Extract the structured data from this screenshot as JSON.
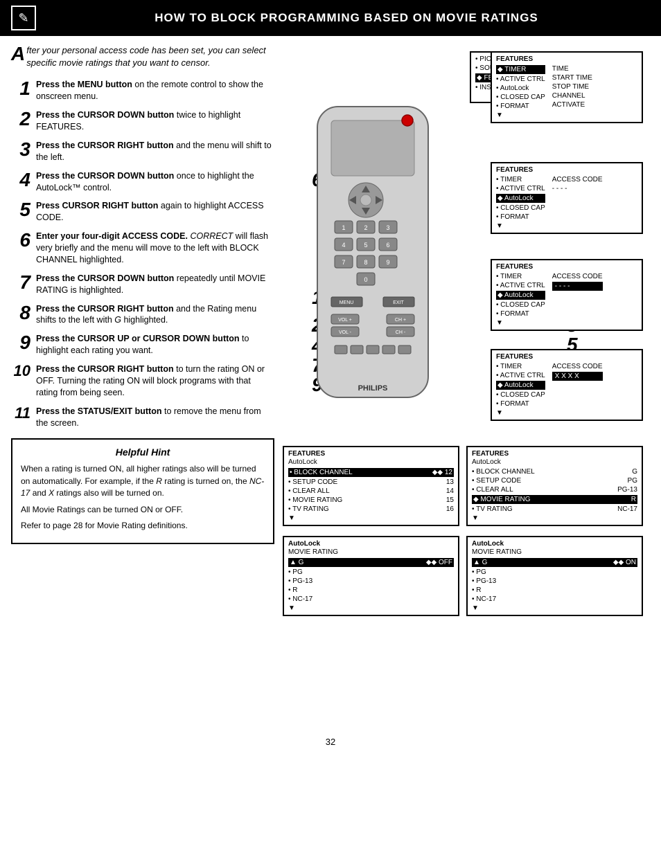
{
  "header": {
    "icon": "📋",
    "title": "How to Block Programming Based on Movie Ratings"
  },
  "intro": {
    "drop_cap": "A",
    "text": "fter your personal access code has been set, you can select specific movie ratings that you want to censor."
  },
  "steps": [
    {
      "number": "1",
      "text_html": "<strong>Press the MENU button</strong> on the remote control to show the onscreen menu."
    },
    {
      "number": "2",
      "text_html": "<strong>Press the CURSOR DOWN button</strong> twice to highlight FEATURES."
    },
    {
      "number": "3",
      "text_html": "<strong>Press the CURSOR RIGHT button</strong> and the menu will shift to the left."
    },
    {
      "number": "4",
      "text_html": "<strong>Press the CURSOR DOWN button</strong> once to highlight the AutoLock™ control."
    },
    {
      "number": "5",
      "text_html": "<strong>Press CURSOR RIGHT button</strong> again to highlight ACCESS CODE."
    },
    {
      "number": "6",
      "text_html": "<strong>Enter your four-digit ACCESS CODE.</strong> <em>CORRECT</em> will flash very briefly and the menu will move to the left with BLOCK CHANNEL highlighted."
    },
    {
      "number": "7",
      "text_html": "<strong>Press the CURSOR DOWN button</strong> repeatedly until MOVIE RATING is highlighted."
    },
    {
      "number": "8",
      "text_html": "<strong>Press the CURSOR RIGHT button</strong> and the Rating menu shifts to the left with <em>G</em> highlighted."
    },
    {
      "number": "9",
      "text_html": "<strong>Press the CURSOR UP or CURSOR DOWN button</strong> to highlight each rating you want."
    },
    {
      "number": "10",
      "text_html": "<strong>Press the CURSOR RIGHT button</strong> to turn the rating ON or OFF. Turning the rating ON will block programs with that rating from being seen."
    },
    {
      "number": "11",
      "text_html": "<strong>Press the STATUS/EXIT button</strong> to remove the menu from the screen."
    }
  ],
  "hint": {
    "title": "Helpful Hint",
    "paragraphs": [
      "When a rating is turned ON, all higher ratings also will be turned on automatically. For example, if the R rating is turned on, the NC-17 and X ratings also will be turned on.",
      "All Movie Ratings can be turned ON or OFF.",
      "Refer to page 28 for Movie Rating definitions."
    ]
  },
  "menu_boxes": {
    "top_left": {
      "header": "",
      "items": [
        {
          "text": "• PICTURE",
          "highlighted": false
        },
        {
          "text": "• SOUND",
          "highlighted": false
        },
        {
          "text": "◆ FEATURES",
          "highlighted": true
        },
        {
          "text": "• INSTALL",
          "highlighted": false
        }
      ],
      "right_items": [
        "TIMER",
        "ACTIVE CTRL",
        "AutoLock",
        "CLOSED CAP",
        "FORMAT"
      ]
    },
    "features_timer": {
      "header": "FEATURES",
      "highlighted_item": "◆ TIMER",
      "items": [
        "• ACTIVE CTRL",
        "• AutoLock",
        "• CLOSED CAP",
        "• FORMAT",
        "▼"
      ],
      "right_col": [
        "TIME",
        "START TIME",
        "STOP TIME",
        "CHANNEL",
        "ACTIVATE"
      ]
    },
    "features_autolock": {
      "header": "FEATURES",
      "items": [
        "• TIMER",
        "• ACTIVE CTRL",
        "◆ AutoLock",
        "• CLOSED CAP",
        "• FORMAT",
        "▼"
      ],
      "right_col": [
        "ACCESS CODE",
        "- - - -"
      ]
    },
    "features_access_code": {
      "header": "FEATURES",
      "items": [
        "• TIMER",
        "• ACTIVE CTRL",
        "◆ AutoLock",
        "• CLOSED CAP",
        "• FORMAT",
        "▼"
      ],
      "access_code_box": "- - - -"
    },
    "features_xxxx": {
      "header": "FEATURES",
      "items": [
        "• TIMER",
        "• ACTIVE CTRL",
        "◆ AutoLock",
        "• CLOSED CAP",
        "• FORMAT",
        "▼"
      ],
      "access_code_box": "X X X X"
    }
  },
  "bottom_menus": {
    "left": {
      "header": "FEATURES",
      "sub": "AutoLock",
      "items": [
        {
          "text": "• BLOCK CHANNEL",
          "value": "◆◆ 12",
          "highlighted": true
        },
        {
          "text": "• SETUP CODE",
          "value": "13"
        },
        {
          "text": "• CLEAR ALL",
          "value": "14"
        },
        {
          "text": "• MOVIE RATING",
          "value": "15"
        },
        {
          "text": "• TV RATING",
          "value": "16"
        },
        {
          "text": "▼"
        }
      ]
    },
    "right": {
      "header": "FEATURES",
      "sub": "AutoLock",
      "items": [
        {
          "text": "• BLOCK CHANNEL",
          "value": "G"
        },
        {
          "text": "• SETUP CODE",
          "value": "PG"
        },
        {
          "text": "• CLEAR ALL",
          "value": "PG-13"
        },
        {
          "text": "◆ MOVIE RATING",
          "value": "R",
          "highlighted": true
        },
        {
          "text": "• TV RATING",
          "value": "NC-17"
        },
        {
          "text": "▼"
        }
      ]
    }
  },
  "rating_menus": {
    "left": {
      "header": "AutoLock",
      "sub": "MOVIE RATING",
      "items": [
        {
          "text": "▲ G",
          "value": "◆◆ OFF",
          "highlighted": true
        },
        {
          "text": "• PG"
        },
        {
          "text": "• PG-13"
        },
        {
          "text": "• R"
        },
        {
          "text": "• NC-17"
        },
        {
          "text": "▼"
        }
      ]
    },
    "right": {
      "header": "AutoLock",
      "sub": "MOVIE RATING",
      "items": [
        {
          "text": "▲ G",
          "value": "◆◆ ON",
          "highlighted": true
        },
        {
          "text": "• PG"
        },
        {
          "text": "• PG-13"
        },
        {
          "text": "• R"
        },
        {
          "text": "• NC-17"
        },
        {
          "text": "▼"
        }
      ]
    }
  },
  "page_number": "32",
  "remote": {
    "brand": "PHILIPS"
  }
}
